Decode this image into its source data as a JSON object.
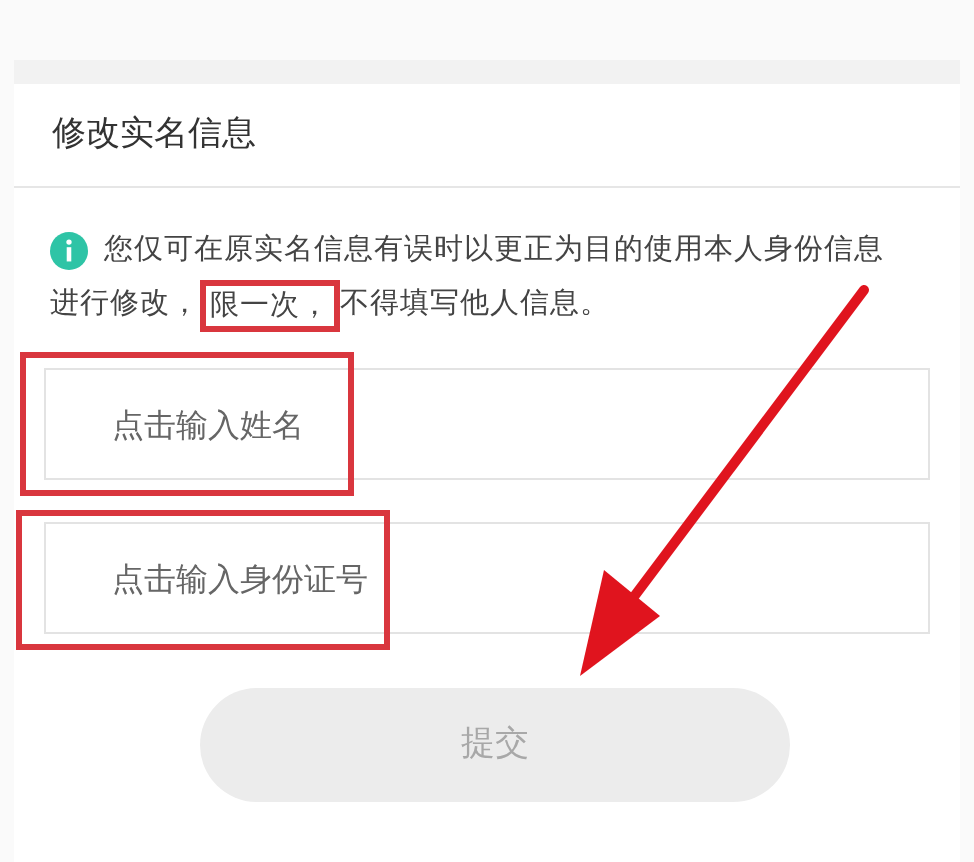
{
  "title": "修改实名信息",
  "notice": [
    [
      {
        "text": "您仅可在原实名信息有误时以更正为目的使用本人身份信息",
        "highlighted": false
      }
    ],
    [
      {
        "text": "进行修改，",
        "highlighted": false
      },
      {
        "text": "限一次，",
        "highlighted": true
      },
      {
        "text": "不得填写他人信息。",
        "highlighted": false
      }
    ]
  ],
  "fields": [
    {
      "placeholder": "点击输入姓名"
    },
    {
      "placeholder": "点击输入身份证号"
    }
  ],
  "submit": {
    "label": "提交",
    "disabled": true
  },
  "annotations": [
    {
      "kind": "box"
    },
    {
      "kind": "box"
    },
    {
      "kind": "arrow"
    }
  ]
}
